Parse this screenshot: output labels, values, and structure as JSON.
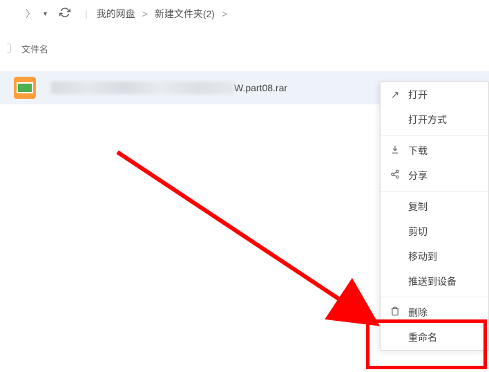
{
  "toolbar": {
    "breadcrumb": [
      {
        "label": "我的网盘"
      },
      {
        "label": "新建文件夹(2)"
      }
    ]
  },
  "columns": {
    "name": "文件名"
  },
  "files": [
    {
      "name_suffix": "W.part08.rar"
    }
  ],
  "context_menu": {
    "open": "打开",
    "open_with": "打开方式",
    "download": "下载",
    "share": "分享",
    "copy": "复制",
    "cut": "剪切",
    "move_to": "移动到",
    "push_to_device": "推送到设备",
    "delete": "删除",
    "rename": "重命名"
  }
}
